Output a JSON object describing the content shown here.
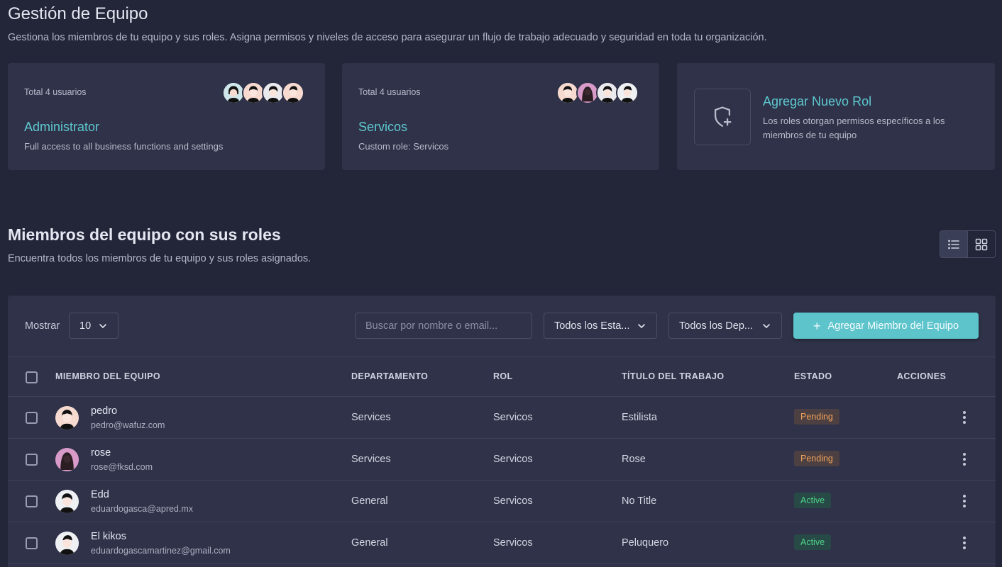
{
  "page": {
    "title": "Gestión de Equipo",
    "description": "Gestiona los miembros de tu equipo y sus roles. Asigna permisos y niveles de acceso para asegurar un flujo de trabajo adecuado y seguridad en toda tu organización."
  },
  "role_cards": [
    {
      "count_label": "Total 4 usuarios",
      "name": "Administrator",
      "description": "Full access to all business functions and settings"
    },
    {
      "count_label": "Total 4 usuarios",
      "name": "Servicos",
      "description": "Custom role: Servicos"
    }
  ],
  "add_role": {
    "title": "Agregar Nuevo Rol",
    "description": "Los roles otorgan permisos específicos a los miembros de tu equipo",
    "icon": "shield-plus-icon"
  },
  "members_section": {
    "title": "Miembros del equipo con sus roles",
    "description": "Encuentra todos los miembros de tu equipo y sus roles asignados."
  },
  "view_toggle": {
    "list_icon": "list-icon",
    "grid_icon": "grid-icon",
    "active": "list"
  },
  "toolbar": {
    "show_label": "Mostrar",
    "page_size": "10",
    "search_placeholder": "Buscar por nombre o email...",
    "status_filter": "Todos los Esta...",
    "department_filter": "Todos los Dep...",
    "add_member_label": "Agregar Miembro del Equipo"
  },
  "table": {
    "headers": {
      "member": "MIEMBRO DEL EQUIPO",
      "department": "DEPARTAMENTO",
      "role": "ROL",
      "job_title": "TÍTULO DEL TRABAJO",
      "status": "ESTADO",
      "actions": "ACCIONES"
    },
    "rows": [
      {
        "name": "pedro",
        "email": "pedro@wafuz.com",
        "department": "Services",
        "role": "Servicos",
        "job_title": "Estilista",
        "status": "Pending"
      },
      {
        "name": "rose",
        "email": "rose@fksd.com",
        "department": "Services",
        "role": "Servicos",
        "job_title": "Rose",
        "status": "Pending"
      },
      {
        "name": "Edd",
        "email": "eduardogasca@apred.mx",
        "department": "General",
        "role": "Servicos",
        "job_title": "No Title",
        "status": "Active"
      },
      {
        "name": "El kikos",
        "email": "eduardogascamartinez@gmail.com",
        "department": "General",
        "role": "Servicos",
        "job_title": "Peluquero",
        "status": "Active"
      }
    ]
  },
  "colors": {
    "background": "#232638",
    "card": "#2f3248",
    "accent": "#5ec9d0",
    "pending": "#f0a25a",
    "active": "#4fd38b"
  }
}
